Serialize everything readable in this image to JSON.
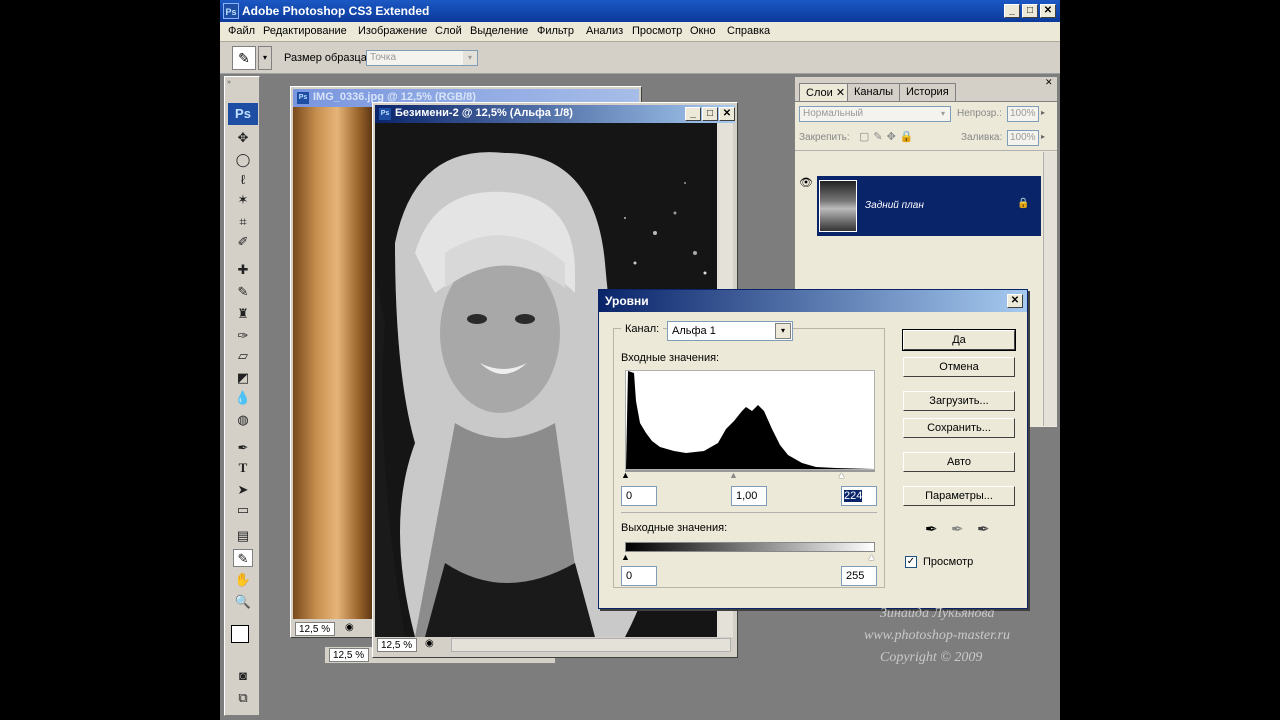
{
  "app": {
    "title": "Adobe Photoshop CS3 Extended",
    "logo": "Ps"
  },
  "menu": [
    "Файл",
    "Редактирование",
    "Изображение",
    "Слой",
    "Выделение",
    "Фильтр",
    "Анализ",
    "Просмотр",
    "Окно",
    "Справка"
  ],
  "options_bar": {
    "sample_size_label": "Размер образца:",
    "sample_size_value": "Точка"
  },
  "toolbox": {
    "logo": "Ps",
    "tools": [
      "move-tool",
      "marquee-tool",
      "lasso-tool",
      "magic-wand-tool",
      "crop-tool",
      "slice-tool",
      "healing-brush-tool",
      "brush-tool",
      "clone-stamp-tool",
      "history-brush-tool",
      "eraser-tool",
      "paint-bucket-tool",
      "blur-tool",
      "dodge-tool",
      "pen-tool",
      "type-tool",
      "path-selection-tool",
      "shape-tool",
      "notes-tool",
      "eyedropper-tool",
      "hand-tool",
      "zoom-tool"
    ]
  },
  "documents": [
    {
      "title": "IMG_0336.jpg @ 12,5% (RGB/8)",
      "zoom": "12,5 %"
    },
    {
      "title": "Безимени-2 @ 12,5% (Альфа 1/8)",
      "zoom": "12,5 %",
      "zoom2": "12,5 %"
    }
  ],
  "layers_panel": {
    "tabs": [
      "Слои",
      "Каналы",
      "История"
    ],
    "blend_mode": "Нормальный",
    "opacity_label": "Непрозр.:",
    "opacity_value": "100%",
    "lock_label": "Закрепить:",
    "fill_label": "Заливка:",
    "fill_value": "100%",
    "layer_name": "Задний план"
  },
  "levels_dialog": {
    "title": "Уровни",
    "channel_label": "Канал:",
    "channel_value": "Альфа 1",
    "input_label": "Входные значения:",
    "input_black": "0",
    "input_gamma": "1,00",
    "input_white": "224",
    "output_label": "Выходные значения:",
    "output_black": "0",
    "output_white": "255",
    "buttons": {
      "ok": "Да",
      "cancel": "Отмена",
      "load": "Загрузить...",
      "save": "Сохранить...",
      "auto": "Авто",
      "options": "Параметры..."
    },
    "preview_label": "Просмотр",
    "preview_checked": true
  },
  "watermark": {
    "author": "Зинаида Лукьянова",
    "site": "www.photoshop-master.ru",
    "copyright": "Copyright © 2009"
  },
  "colors": {
    "title_active": "#0a246a",
    "title_blue": "#0b3a9a",
    "face": "#ece9d8"
  }
}
